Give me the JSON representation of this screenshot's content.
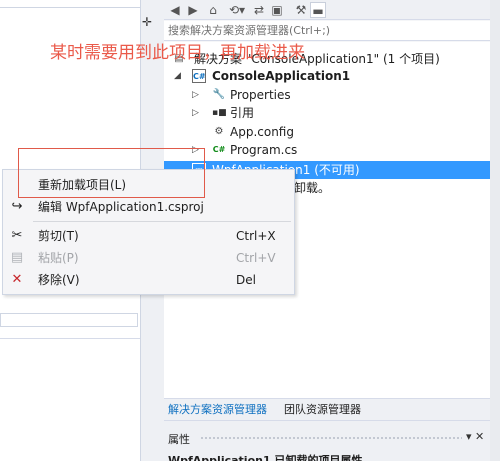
{
  "annotation": "某时需要用到此项目，再加载进来",
  "solution_explorer": {
    "search_placeholder": "搜索解决方案资源管理器(Ctrl+;)",
    "solution_label": "解决方案 \"ConsoleApplication1\" (1 个项目)",
    "project_label": "ConsoleApplication1",
    "items": [
      {
        "label": "Properties",
        "icon": "wrench-icon"
      },
      {
        "label": "引用",
        "icon": "references-icon"
      },
      {
        "label": "App.config",
        "icon": "config-icon"
      },
      {
        "label": "Program.cs",
        "icon": "csharp-icon"
      }
    ],
    "selected_project": "WpfApplication1 (不可用)",
    "unloaded_note": "卸载。",
    "tabs": {
      "solution": "解决方案资源管理器",
      "team": "团队资源管理器"
    }
  },
  "properties": {
    "title": "属性",
    "subject": "WpfApplication1 已卸载的项目属性"
  },
  "context_menu": {
    "items": [
      {
        "label": "重新加载项目(L)",
        "key": "",
        "icon": "reload-icon",
        "enabled": true
      },
      {
        "label": "编辑 WpfApplication1.csproj",
        "key": "",
        "icon": "edit-icon",
        "enabled": true
      },
      {
        "label": "剪切(T)",
        "key": "Ctrl+X",
        "icon": "cut-icon",
        "enabled": true
      },
      {
        "label": "粘贴(P)",
        "key": "Ctrl+V",
        "icon": "paste-icon",
        "enabled": false
      },
      {
        "label": "移除(V)",
        "key": "Del",
        "icon": "remove-icon",
        "enabled": true
      }
    ]
  },
  "colors": {
    "annotation": "#ea5a4a",
    "selection": "#3399ff",
    "accent": "#0e70c0"
  }
}
